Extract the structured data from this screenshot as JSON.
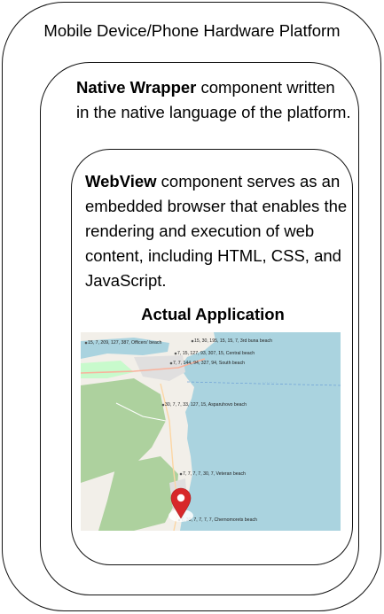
{
  "outer": {
    "title": "Mobile Device/Phone Hardware Platform"
  },
  "native_wrapper": {
    "bold": "Native Wrapper",
    "text": " component written in the native language of the platform."
  },
  "webview": {
    "bold": "WebView",
    "text": " component serves as an embedded browser that enables the rendering and execution of web content, including HTML, CSS, and JavaScript."
  },
  "app": {
    "title": "Actual Application",
    "beaches": [
      "15, 7, 209, 127, 387, Officers' beach",
      "15, 30, 195, 15, 15, 7, 3rd buna beach",
      "7, 15, 127, 93, 307, 15, Central beach",
      "7, 7, 144, 94, 327, 94, South beach",
      "30, 7, 7, 33, 127, 15, Asparuhovo beach",
      "7, 7, 7, 7, 30, 7, Veteran beach",
      "7, 30, 7, 7, 7, 7, Chernomorets beach"
    ]
  },
  "colors": {
    "sea": "#aad3df",
    "land": "#f2efe9",
    "forest": "#add19e",
    "park": "#c8facc",
    "marker": "#d7282a"
  }
}
